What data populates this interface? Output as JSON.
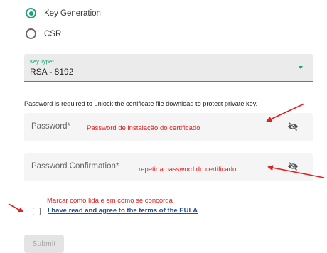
{
  "key_options": [
    {
      "label": "Key Generation",
      "selected": true
    },
    {
      "label": "CSR",
      "selected": false
    }
  ],
  "key_type": {
    "caption": "Key Type*",
    "value": "RSA - 8192"
  },
  "info_text": "Password is required to unlock the certificate file download to protect private key.",
  "password": {
    "label": "Password*",
    "note": "Password de instalação do certificado"
  },
  "password_confirmation": {
    "label": "Password Confirmation*",
    "note": "repetir a password do certificado"
  },
  "eula": {
    "note": "Marcar como lida e em como se concorda",
    "link": "I have read and agree to the terms of the EULA",
    "checked": false
  },
  "submit_label": "Submit",
  "colors": {
    "accent": "#1aa37a",
    "annotation": "#e02020",
    "link": "#1f4e9a"
  },
  "icons": {
    "password_toggle": "eye-off-icon",
    "annotation_arrow": "red-arrow"
  }
}
